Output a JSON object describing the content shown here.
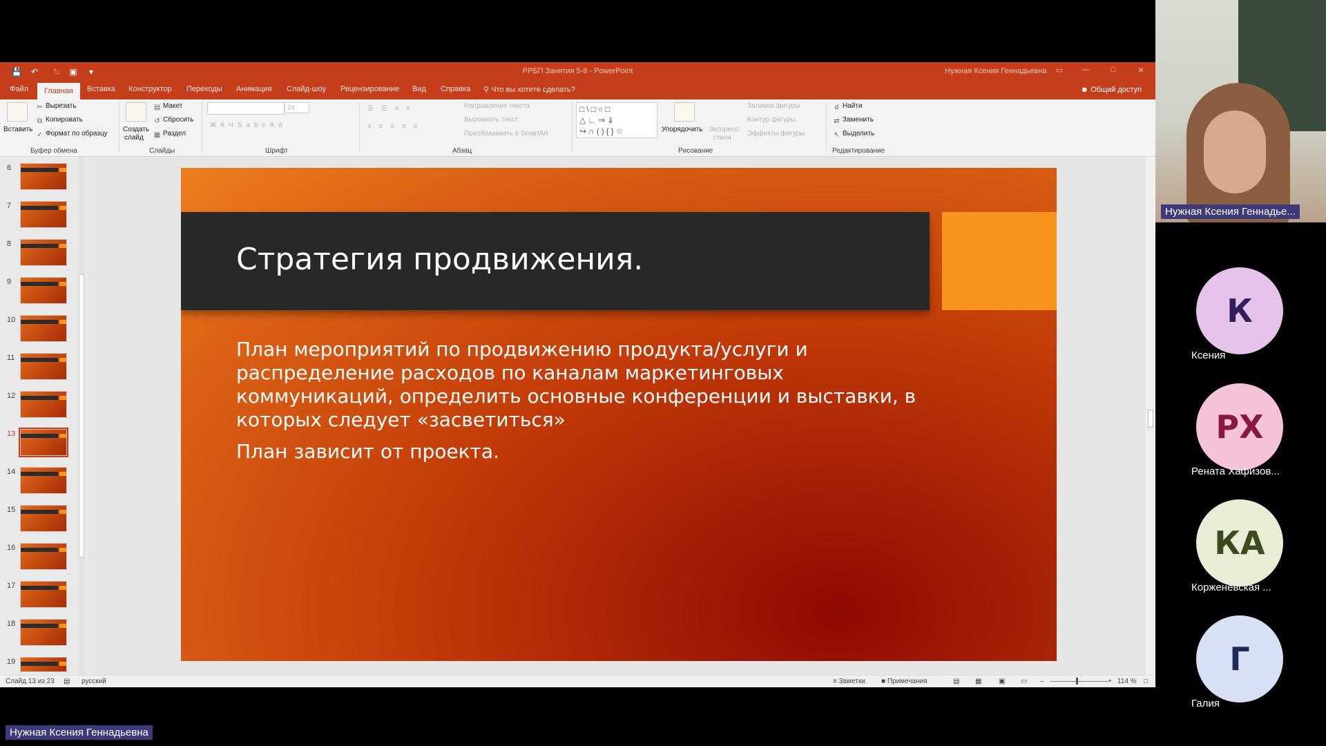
{
  "window": {
    "doc_title": "РРБП Занятия 5-8 - PowerPoint",
    "user": "Нужная Ксения Геннадьевна"
  },
  "tabs": [
    "Файл",
    "Главная",
    "Вставка",
    "Конструктор",
    "Переходы",
    "Анимация",
    "Слайд-шоу",
    "Рецензирование",
    "Вид",
    "Справка"
  ],
  "tell_me": "Что вы хотите сделать?",
  "share": "Общий доступ",
  "ribbon": {
    "clipboard": {
      "paste": "Вставить",
      "cut": "Вырезать",
      "copy": "Копировать",
      "format": "Формат по образцу",
      "label": "Буфер обмена"
    },
    "slides": {
      "new_slide_1": "Создать",
      "new_slide_2": "слайд",
      "layout": "Макет",
      "reset": "Сбросить",
      "section": "Раздел",
      "label": "Слайды"
    },
    "font": {
      "size": "24",
      "label": "Шрифт"
    },
    "paragraph": {
      "dir": "Направление текста",
      "align": "Выровнять текст",
      "smartart": "Преобразовать в SmartArt",
      "label": "Абзац"
    },
    "drawing": {
      "arrange": "Упорядочить",
      "quick_styles_1": "Экспресс-",
      "quick_styles_2": "стили",
      "fill": "Заливка фигуры",
      "outline": "Контур фигуры",
      "effects": "Эффекты фигуры",
      "label": "Рисование"
    },
    "editing": {
      "find": "Найти",
      "replace": "Заменить",
      "select": "Выделить",
      "label": "Редактирование"
    }
  },
  "thumbnails": {
    "numbers": [
      "6",
      "7",
      "8",
      "9",
      "10",
      "11",
      "12",
      "13",
      "14",
      "15",
      "16",
      "17",
      "18",
      "19"
    ],
    "selected": "13"
  },
  "slide": {
    "title": "Стратегия продвижения.",
    "para1": "План мероприятий по продвижению продукта/услуги и распределение расходов по каналам маркетинговых коммуникаций, определить основные конференции и выставки, в которых следует «засветиться»",
    "para2": "План зависит от проекта."
  },
  "status": {
    "slide_of": "Слайд 13 из 23",
    "lang": "русский",
    "notes": "Заметки",
    "comments": "Примечания",
    "zoom": "114 %"
  },
  "participants": {
    "self_name": "Нужная Ксения Геннадье...",
    "bottom_name": "Нужная Ксения Геннадьевна",
    "list": [
      {
        "initials": "К",
        "name": "Ксения",
        "bg": "#e6c4ea",
        "fg": "#2f1f5a"
      },
      {
        "initials": "РХ",
        "name": "Рената Хафизов...",
        "bg": "#f6c2d9",
        "fg": "#8a1743"
      },
      {
        "initials": "КА",
        "name": "Корженевская ...",
        "bg": "#e7eed5",
        "fg": "#3d4a1e"
      },
      {
        "initials": "Г",
        "name": "Галия",
        "bg": "#d8e0f5",
        "fg": "#1d2a57"
      }
    ]
  }
}
